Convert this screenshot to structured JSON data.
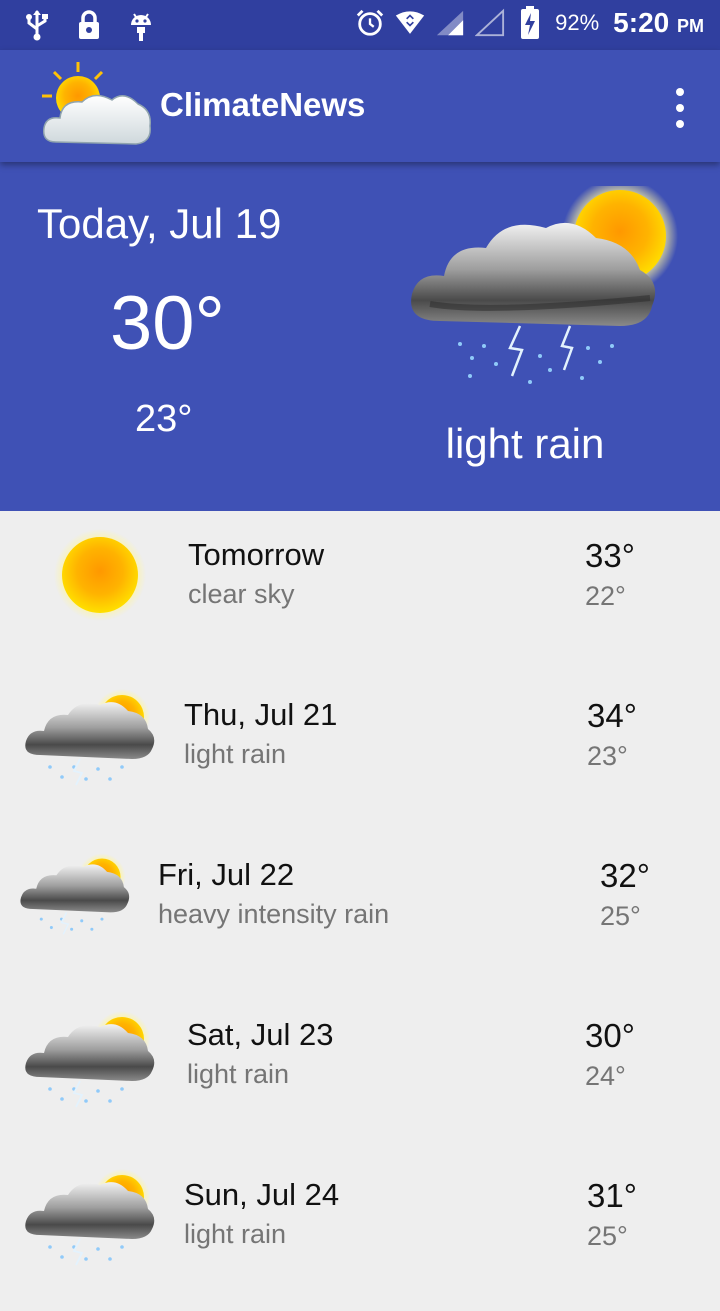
{
  "status_bar": {
    "battery": "92%",
    "time": "5:20",
    "ampm": "PM"
  },
  "app": {
    "title": "ClimateNews"
  },
  "today": {
    "date": "Today, Jul 19",
    "high": "30°",
    "low": "23°",
    "description": "light rain",
    "icon": "storm-sun-icon"
  },
  "forecast": [
    {
      "day": "Tomorrow",
      "desc": "clear sky",
      "high": "33°",
      "low": "22°",
      "icon": "sun-icon"
    },
    {
      "day": "Thu, Jul 21",
      "desc": "light rain",
      "high": "34°",
      "low": "23°",
      "icon": "storm-sun-icon"
    },
    {
      "day": "Fri, Jul 22",
      "desc": "heavy intensity rain",
      "high": "32°",
      "low": "25°",
      "icon": "storm-sun-icon"
    },
    {
      "day": "Sat, Jul 23",
      "desc": "light rain",
      "high": "30°",
      "low": "24°",
      "icon": "storm-sun-icon"
    },
    {
      "day": "Sun, Jul 24",
      "desc": "light rain",
      "high": "31°",
      "low": "25°",
      "icon": "storm-sun-icon"
    }
  ],
  "colors": {
    "status_bar": "#303f9f",
    "primary": "#3f51b5",
    "list_background": "#eeeeee"
  }
}
